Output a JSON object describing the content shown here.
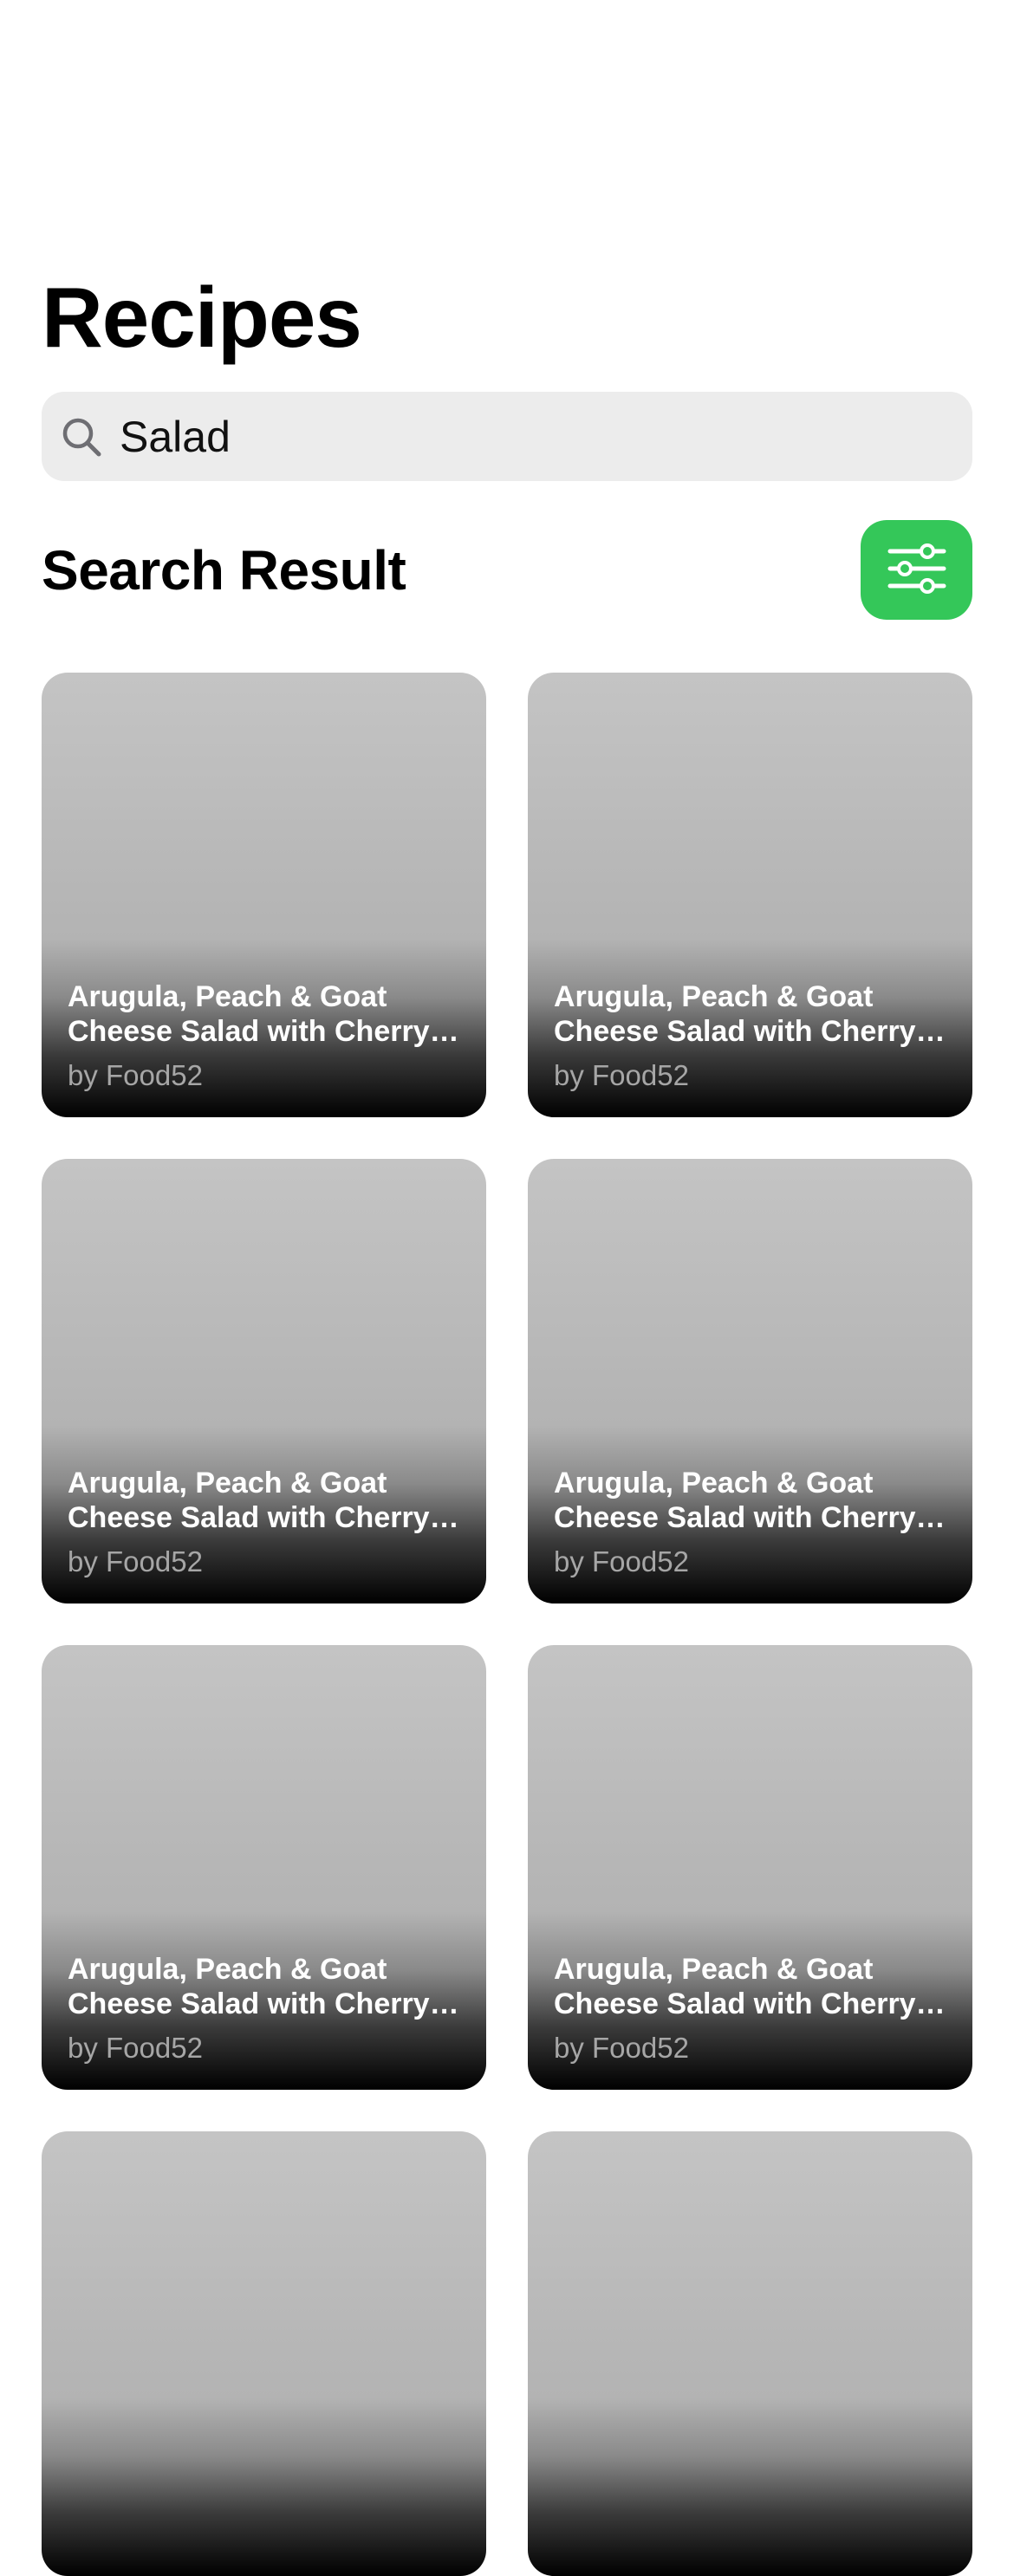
{
  "header": {
    "title": "Recipes"
  },
  "search": {
    "value": "Salad",
    "icon": "search-icon"
  },
  "results": {
    "title": "Search Result",
    "filter_icon": "sliders-icon",
    "accent_color": "#34c759"
  },
  "cards": [
    {
      "title": "Arugula, Peach & Goat Cheese Salad with Cherry Tomatoes",
      "author": "by Food52"
    },
    {
      "title": "Arugula, Peach & Goat Cheese Salad with Cherry Tomatoes",
      "author": "by Food52"
    },
    {
      "title": "Arugula, Peach & Goat Cheese Salad with Cherry Tomatoes",
      "author": "by Food52"
    },
    {
      "title": "Arugula, Peach & Goat Cheese Salad with Cherry Tomatoes",
      "author": "by Food52"
    },
    {
      "title": "Arugula, Peach & Goat Cheese Salad with Cherry Tomatoes",
      "author": "by Food52"
    },
    {
      "title": "Arugula, Peach & Goat Cheese Salad with Cherry Tomatoes",
      "author": "by Food52"
    },
    {
      "title": "",
      "author": ""
    },
    {
      "title": "",
      "author": ""
    }
  ]
}
